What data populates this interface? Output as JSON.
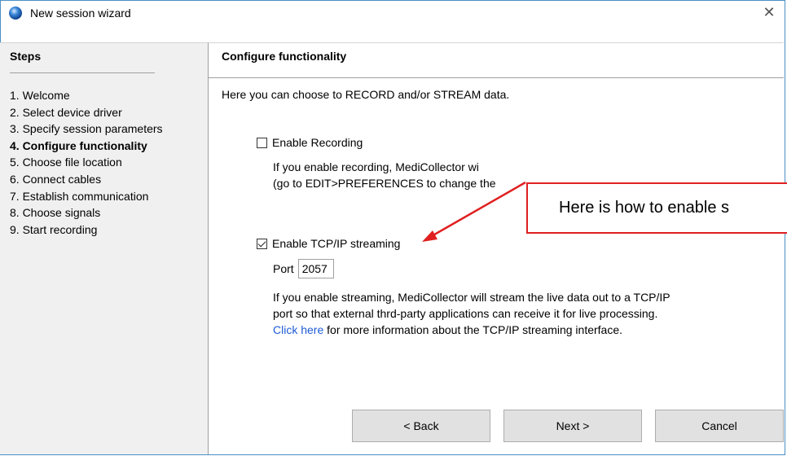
{
  "window": {
    "title": "New session wizard",
    "close_glyph": "✕",
    "app_icon": "blue-sphere-icon"
  },
  "steps": {
    "header": "Steps",
    "items": [
      {
        "label": "1. Welcome",
        "current": false
      },
      {
        "label": "2. Select device driver",
        "current": false
      },
      {
        "label": "3. Specify session parameters",
        "current": false
      },
      {
        "label": "4. Configure functionality",
        "current": true
      },
      {
        "label": "5. Choose file location",
        "current": false
      },
      {
        "label": "6. Connect cables",
        "current": false
      },
      {
        "label": "7. Establish communication",
        "current": false
      },
      {
        "label": "8. Choose signals",
        "current": false
      },
      {
        "label": "9. Start recording",
        "current": false
      }
    ]
  },
  "main": {
    "header": "Configure functionality",
    "intro": "Here you can choose to RECORD and/or STREAM data.",
    "recording": {
      "label": "Enable Recording",
      "checked": false,
      "desc_line1": "If you enable recording, MediCollector wi",
      "desc_line2": "(go to EDIT>PREFERENCES to change the"
    },
    "streaming": {
      "label": "Enable TCP/IP streaming",
      "checked": true,
      "port_label": "Port",
      "port_value": "2057",
      "desc_line1": "If you enable streaming, MediCollector will stream the live data out to a TCP/IP",
      "desc_line2": "port so that external thrd-party applications can receive it for live processing.",
      "link_text": "Click here",
      "link_rest": " for more information about the TCP/IP streaming interface."
    }
  },
  "buttons": {
    "back": "< Back",
    "next": "Next >",
    "cancel": "Cancel"
  },
  "annotation": {
    "text": "Here is how to enable s",
    "color": "#e02020"
  }
}
